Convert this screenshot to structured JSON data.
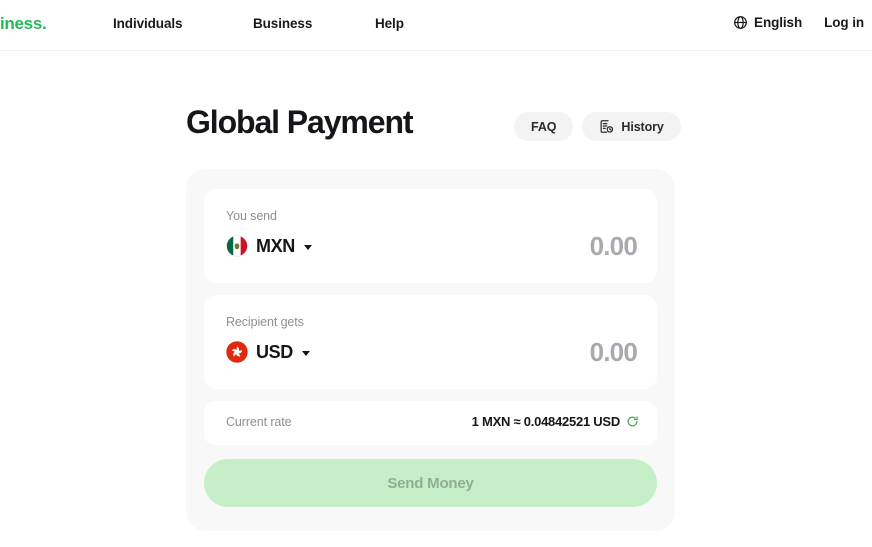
{
  "header": {
    "logo_text": "iness.",
    "logo_color": "#22bb55",
    "nav_items": [
      {
        "label": "Individuals"
      },
      {
        "label": "Business"
      },
      {
        "label": "Help"
      }
    ],
    "language": {
      "icon": "globe-icon",
      "label": "English"
    },
    "login_label": "Log in"
  },
  "main": {
    "page_title": "Global Payment",
    "actions": [
      {
        "id": "faq",
        "label": "FAQ",
        "icon": null
      },
      {
        "id": "history",
        "label": "History",
        "icon": "history-icon"
      }
    ],
    "converter": {
      "send": {
        "label": "You send",
        "currency_code": "MXN",
        "flag": "mexico-flag",
        "amount_value": "0.00",
        "amount_placeholder": "0.00"
      },
      "receive": {
        "label": "Recipient gets",
        "currency_code": "USD",
        "flag": "hong-kong-flag",
        "amount_value": "0.00",
        "amount_placeholder": "0.00"
      },
      "rate": {
        "label": "Current rate",
        "value": "1 MXN ≈ 0.04842521 USD",
        "base_currency": "MXN",
        "base_amount": "1",
        "quote_currency": "USD",
        "quote_amount": "0.04842521",
        "refresh_icon": "refresh-icon",
        "refresh_color": "#4caf50"
      },
      "submit": {
        "label": "Send Money",
        "enabled": false,
        "background": "#c6efc8",
        "text_color": "#8fae93"
      }
    }
  }
}
